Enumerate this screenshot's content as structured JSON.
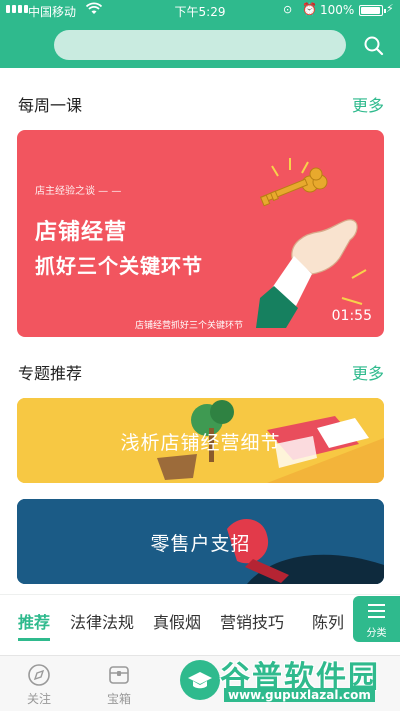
{
  "status_bar": {
    "carrier": "中国移动",
    "time": "下午5:29",
    "battery": "100%"
  },
  "search": {
    "placeholder": ""
  },
  "weekly": {
    "title": "每周一课",
    "more": "更多",
    "card": {
      "tag": "店主经验之谈 — —",
      "line1": "店铺经营",
      "line2": "抓好三个关键环节",
      "caption": "店铺经营抓好三个关键环节",
      "duration": "01:55",
      "color": "#f2555f"
    }
  },
  "topics": {
    "title": "专题推荐",
    "more": "更多",
    "items": [
      {
        "title": "浅析店铺经营细节",
        "color": "#f7c843"
      },
      {
        "title": "零售户支招",
        "color": "#1b5b86"
      }
    ]
  },
  "category_tabs": {
    "items": [
      "推荐",
      "法律法规",
      "真假烟",
      "营销技巧",
      "陈列"
    ],
    "active": "推荐",
    "menu_label": "分类"
  },
  "bottom_nav": {
    "items": [
      {
        "label": "关注",
        "icon": "compass-icon"
      },
      {
        "label": "宝箱",
        "icon": "box-icon"
      },
      {
        "label": "",
        "icon": "graduation-cap-icon"
      }
    ]
  },
  "watermark": {
    "text": "谷普软件园",
    "url": "www.gupuxlazal.com"
  },
  "theme": {
    "accent": "#2fba8d",
    "search_bg": "#c9ebe0"
  }
}
